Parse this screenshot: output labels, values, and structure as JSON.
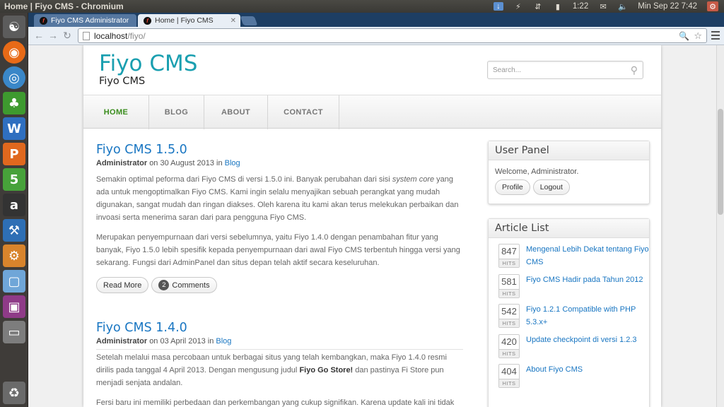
{
  "os": {
    "window_title": "Home | Fiyo CMS - Chromium",
    "tray": {
      "time_remaining": "1:22",
      "datetime": "Min Sep 22  7:42"
    }
  },
  "launcher": {
    "items": [
      {
        "name": "ubuntu-home",
        "glyph": "⚉",
        "color": "#5c5c5c"
      },
      {
        "name": "firefox",
        "glyph": "◉",
        "color": "#e86a17"
      },
      {
        "name": "chromium",
        "glyph": "◎",
        "color": "#3a87c8"
      },
      {
        "name": "game-app",
        "glyph": "♣",
        "color": "#3e9a2f"
      },
      {
        "name": "libreoffice-writer",
        "glyph": "W",
        "color": "#2f6fc0"
      },
      {
        "name": "libreoffice-impress",
        "glyph": "P",
        "color": "#e0681e"
      },
      {
        "name": "spreadsheet",
        "glyph": "5",
        "color": "#47a23a"
      },
      {
        "name": "amazon",
        "glyph": "a",
        "color": "#333333"
      },
      {
        "name": "system-tool",
        "glyph": "⚒",
        "color": "#2e6fb5"
      },
      {
        "name": "settings-app",
        "glyph": "⚙",
        "color": "#d8842c"
      },
      {
        "name": "package-app",
        "glyph": "▢",
        "color": "#6fa6d8"
      },
      {
        "name": "workspace-switcher",
        "glyph": "▣",
        "color": "#8f3b88"
      },
      {
        "name": "drive",
        "glyph": "▭",
        "color": "#7d7d7d"
      },
      {
        "name": "trash",
        "glyph": "♻",
        "color": "#6a6a6a"
      }
    ]
  },
  "browser": {
    "tabs": [
      {
        "title": "Fiyo CMS Administrator",
        "active": false
      },
      {
        "title": "Home | Fiyo CMS",
        "active": true
      }
    ],
    "url": {
      "host": "localhost",
      "path": "/fiyo/"
    }
  },
  "site": {
    "title": "Fiyo CMS",
    "subtitle": "Fiyo CMS",
    "search_placeholder": "Search...",
    "nav": [
      "HOME",
      "BLOG",
      "ABOUT",
      "CONTACT"
    ],
    "posts": [
      {
        "title": "Fiyo CMS 1.5.0",
        "author": "Administrator",
        "on": "on",
        "date": "30 August 2013",
        "in": "in",
        "category": "Blog",
        "p1a": "Semakin optimal peforma dari Fiyo CMS di versi 1.5.0 ini. Banyak perubahan dari sisi ",
        "p1em": "system core",
        "p1b": " yang ada untuk mengoptimalkan Fiyo CMS. Kami ingin selalu menyajikan sebuah perangkat yang mudah digunakan, sangat mudah dan ringan diakses. Oleh karena itu kami akan terus melekukan perbaikan dan invoasi serta menerima saran dari para pengguna Fiyo CMS.",
        "p2": "Merupakan penyempurnaan dari versi sebelumnya, yaitu Fiyo 1.4.0 dengan penambahan fitur yang banyak, Fiyo 1.5.0 lebih spesifik kepada penyempurnaan dari awal Fiyo CMS terbentuh hingga versi yang sekarang. Fungsi dari AdminPanel dan situs depan telah aktif secara keseluruhan.",
        "read_more": "Read More",
        "comment_count": "2",
        "comments_label": "Comments"
      },
      {
        "title": "Fiyo CMS 1.4.0",
        "author": "Administrator",
        "on": "on",
        "date": "03 April 2013",
        "in": "in",
        "category": "Blog",
        "p1a": "Setelah melalui masa percobaan untuk berbagai situs yang telah kembangkan, maka Fiyo 1.4.0 resmi dirilis pada tanggal 4 April 2013. Dengan mengusung judul ",
        "p1strong": "Fiyo Go Store!",
        "p1b": " dan pastinya Fi Store pun menjadi senjata andalan.",
        "p2": "Fersi baru ini memiliki perbedaan dan perkembangan yang cukup signifikan. Karena update kali ini tidak"
      }
    ],
    "user_panel": {
      "heading": "User Panel",
      "welcome": "Welcome, Administrator.",
      "profile": "Profile",
      "logout": "Logout"
    },
    "article_list": {
      "heading": "Article List",
      "hits_label": "HITS",
      "items": [
        {
          "hits": "847",
          "title": "Mengenal Lebih Dekat tentang Fiyo CMS"
        },
        {
          "hits": "581",
          "title": "Fiyo CMS Hadir pada Tahun 2012"
        },
        {
          "hits": "542",
          "title": "Fiyo 1.2.1 Compatible with PHP 5.3.x+"
        },
        {
          "hits": "420",
          "title": "Update checkpoint di versi 1.2.3"
        },
        {
          "hits": "404",
          "title": "About Fiyo CMS"
        }
      ]
    }
  }
}
